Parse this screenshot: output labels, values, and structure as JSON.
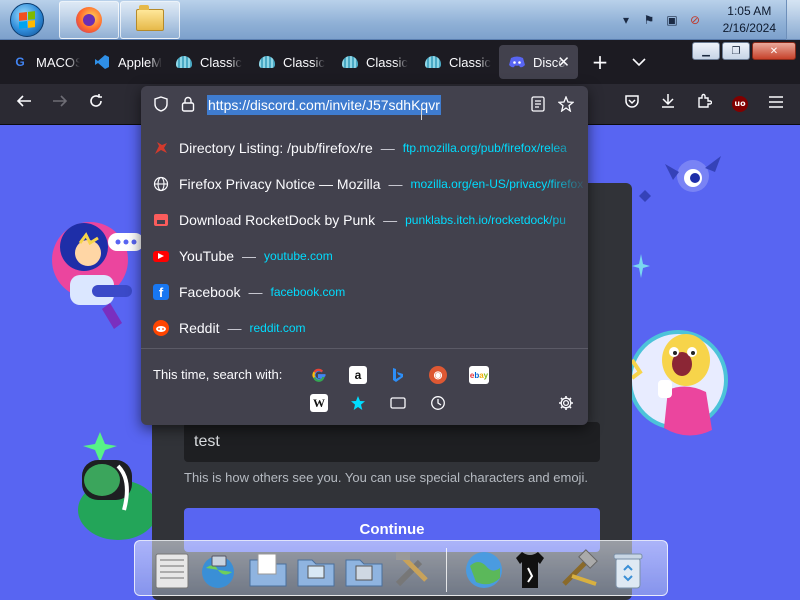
{
  "taskbar": {
    "start_label": "Start",
    "apps": [
      {
        "name": "Firefox",
        "icon": "firefox-icon"
      },
      {
        "name": "Windows Explorer",
        "icon": "folder-icon"
      }
    ],
    "clock": {
      "time": "1:05 AM",
      "date": "2/16/2024"
    },
    "tray_icons": [
      "chevron-up-icon",
      "flag-icon",
      "network-icon",
      "volume-muted-icon"
    ]
  },
  "tabs": [
    {
      "title": "MACOS",
      "favicon": "G",
      "favicon_color": "#4285f4"
    },
    {
      "title": "AppleM",
      "favicon": "vscode-icon",
      "favicon_color": "#2f8fe6"
    },
    {
      "title": "Classic",
      "favicon": "shell-icon"
    },
    {
      "title": "Classic",
      "favicon": "shell-icon"
    },
    {
      "title": "Classic",
      "favicon": "shell-icon"
    },
    {
      "title": "Classic",
      "favicon": "shell-icon"
    },
    {
      "title": "Discord",
      "favicon": "discord-icon",
      "active": true
    }
  ],
  "tabstrip": {
    "new_tab": "+",
    "list_all_tabs": "⌄"
  },
  "window_controls": {
    "minimize": "▁",
    "restore": "❐",
    "close": "✕"
  },
  "urlbar": {
    "value": "https://discord.com/invite/J57sdhKqvr"
  },
  "suggestions": [
    {
      "title": "Directory Listing: /pub/firefox/re",
      "url": "ftp.mozilla.org/pub/firefox/relea",
      "favicon": "dragon-icon",
      "color": "#d33a2c"
    },
    {
      "title": "Firefox Privacy Notice — Mozilla",
      "url": "mozilla.org/en-US/privacy/firefox",
      "favicon": "globe-icon",
      "color": "#fbfbfe"
    },
    {
      "title": "Download RocketDock by Punk",
      "url": "punklabs.itch.io/rocketdock/pu",
      "favicon": "itch-icon",
      "color": "#fa5c5c"
    },
    {
      "title": "YouTube",
      "url": "youtube.com",
      "favicon": "youtube-icon",
      "color": "#ff0000"
    },
    {
      "title": "Facebook",
      "url": "facebook.com",
      "favicon": "facebook-icon",
      "color": "#1877f2"
    },
    {
      "title": "Reddit",
      "url": "reddit.com",
      "favicon": "reddit-icon",
      "color": "#ff4500"
    }
  ],
  "search_with": {
    "label": "This time, search with:",
    "engines": [
      "google-icon",
      "amazon-icon",
      "bing-icon",
      "duckduckgo-icon",
      "ebay-icon",
      "wikipedia-icon",
      "bookmarks-icon",
      "tabs-icon",
      "history-icon"
    ]
  },
  "discord_form": {
    "name_value": "test",
    "helper": "This is how others see you. You can use special characters and emoji.",
    "continue_label": "Continue"
  },
  "colors": {
    "discord_blurple": "#5865f2",
    "firefox_dark": "#1c1b22",
    "toolbar": "#2b2a33",
    "panel": "#42414d",
    "url_highlight": "#3f7ccf",
    "link_cyan": "#00ddff"
  }
}
